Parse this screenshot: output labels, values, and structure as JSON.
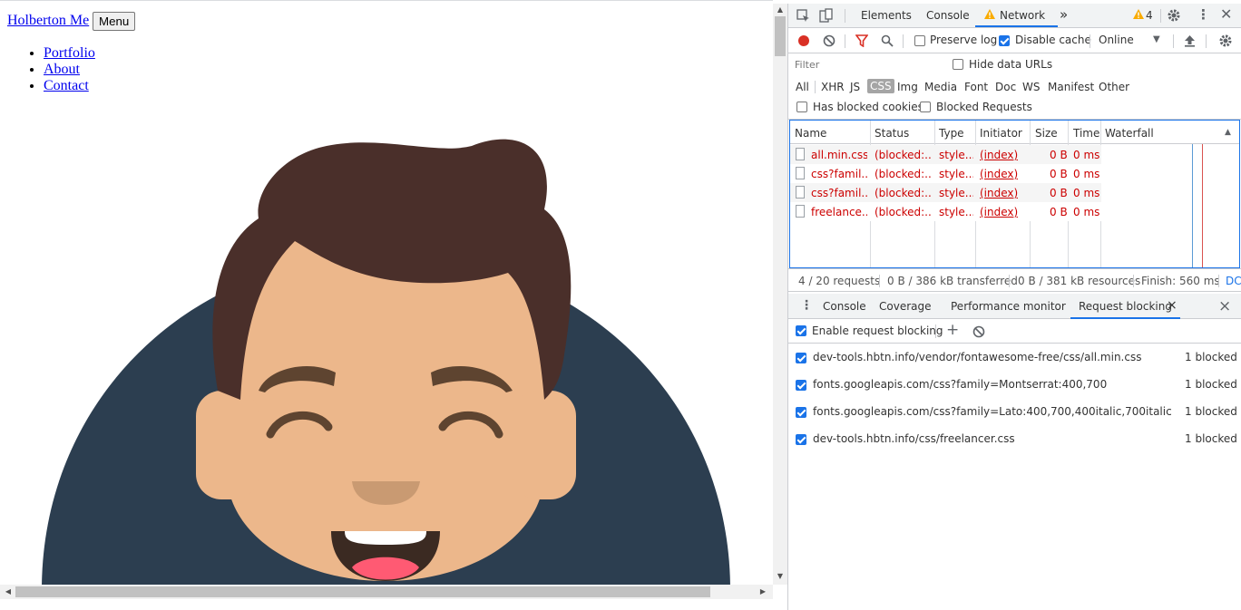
{
  "page": {
    "brand": "Holberton Me",
    "menu_button": "Menu",
    "nav": [
      {
        "label": "Portfolio"
      },
      {
        "label": "About"
      },
      {
        "label": "Contact"
      }
    ]
  },
  "devtools": {
    "tabs": {
      "elements": "Elements",
      "console": "Console",
      "network": "Network",
      "more": "»",
      "warnings": "4"
    },
    "toolbar": {
      "preserve_log": "Preserve log",
      "disable_cache": "Disable cache",
      "throttling": "Online"
    },
    "filter": {
      "placeholder": "Filter",
      "hide_data_urls": "Hide data URLs"
    },
    "types": [
      "All",
      "XHR",
      "JS",
      "CSS",
      "Img",
      "Media",
      "Font",
      "Doc",
      "WS",
      "Manifest",
      "Other"
    ],
    "selected_type": "CSS",
    "blocked": {
      "has_blocked_cookies": "Has blocked cookies",
      "blocked_requests": "Blocked Requests"
    },
    "columns": {
      "name": "Name",
      "status": "Status",
      "type": "Type",
      "initiator": "Initiator",
      "size": "Size",
      "time": "Time",
      "waterfall": "Waterfall"
    },
    "requests": [
      {
        "name": "all.min.css",
        "status": "(blocked:...",
        "type": "style...",
        "initiator": "(index)",
        "size": "0 B",
        "time": "0 ms"
      },
      {
        "name": "css?famil...",
        "status": "(blocked:...",
        "type": "style...",
        "initiator": "(index)",
        "size": "0 B",
        "time": "0 ms"
      },
      {
        "name": "css?famil...",
        "status": "(blocked:...",
        "type": "style...",
        "initiator": "(index)",
        "size": "0 B",
        "time": "0 ms"
      },
      {
        "name": "freelance...",
        "status": "(blocked:...",
        "type": "style...",
        "initiator": "(index)",
        "size": "0 B",
        "time": "0 ms"
      }
    ],
    "status": {
      "requests": "4 / 20 requests",
      "transferred": "0 B / 386 kB transferred",
      "resources": "0 B / 381 kB resources",
      "finish": "Finish: 560 ms",
      "dom": "DC"
    },
    "drawer": {
      "console": "Console",
      "coverage": "Coverage",
      "performance_monitor": "Performance monitor",
      "request_blocking": "Request blocking",
      "close_tab": "×",
      "close_drawer": "×"
    },
    "request_blocking": {
      "enable_label": "Enable request blocking",
      "patterns": [
        {
          "url": "dev-tools.hbtn.info/vendor/fontawesome-free/css/all.min.css",
          "count": "1 blocked"
        },
        {
          "url": "fonts.googleapis.com/css?family=Montserrat:400,700",
          "count": "1 blocked"
        },
        {
          "url": "fonts.googleapis.com/css?family=Lato:400,700,400italic,700italic",
          "count": "1 blocked"
        },
        {
          "url": "dev-tools.hbtn.info/css/freelancer.css",
          "count": "1 blocked"
        }
      ]
    }
  },
  "colors": {
    "link": "#0000ee",
    "accent": "#1a73e8",
    "error": "#cc0000",
    "avatar_bg": "#2c3e50",
    "hair": "#4a2f2a",
    "skin": "#ecb78b"
  }
}
